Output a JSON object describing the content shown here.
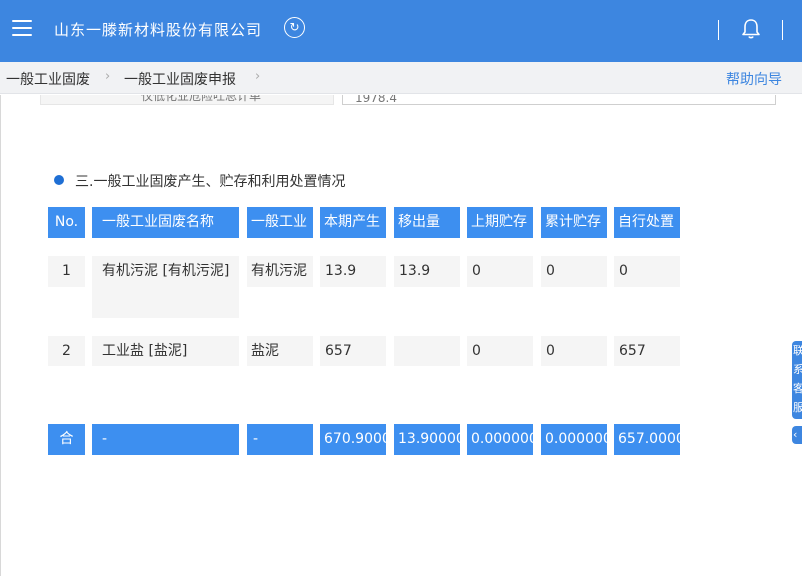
{
  "header": {
    "title": "山东一滕新材料股份有限公司",
    "menu_icon": "hamburger-menu-icon",
    "refresh_icon": "refresh-icon",
    "bell_icon": "bell-icon",
    "refresh_glyph": "↻"
  },
  "breadcrumb": {
    "items": [
      "一般工业固废",
      "一般工业固废申报"
    ],
    "separator": "›",
    "help": "帮助向导"
  },
  "previous_row": {
    "label": "仅低化业危险吐总计单",
    "value": "1978.4"
  },
  "section": {
    "title": "三.一般工业固废产生、贮存和利用处置情况"
  },
  "table": {
    "headers": [
      "No.",
      "一般工业固废名称",
      "一般工业",
      "本期产生",
      "移出量",
      "上期贮存",
      "累计贮存",
      "自行处置"
    ],
    "rows": [
      [
        "1",
        "有机污泥 [有机污泥]",
        "有机污泥",
        "13.9",
        "13.9",
        "0",
        "0",
        "0"
      ],
      [
        "2",
        "工业盐 [盐泥]",
        "盐泥",
        "657",
        "",
        "0",
        "0",
        "657"
      ]
    ],
    "total": [
      "合",
      "-",
      "-",
      "670.9000",
      "13.90000",
      "0.000000",
      "0.000000",
      "657.0000"
    ]
  },
  "side_tab": {
    "label": "联系客服",
    "arrow": "‹"
  }
}
